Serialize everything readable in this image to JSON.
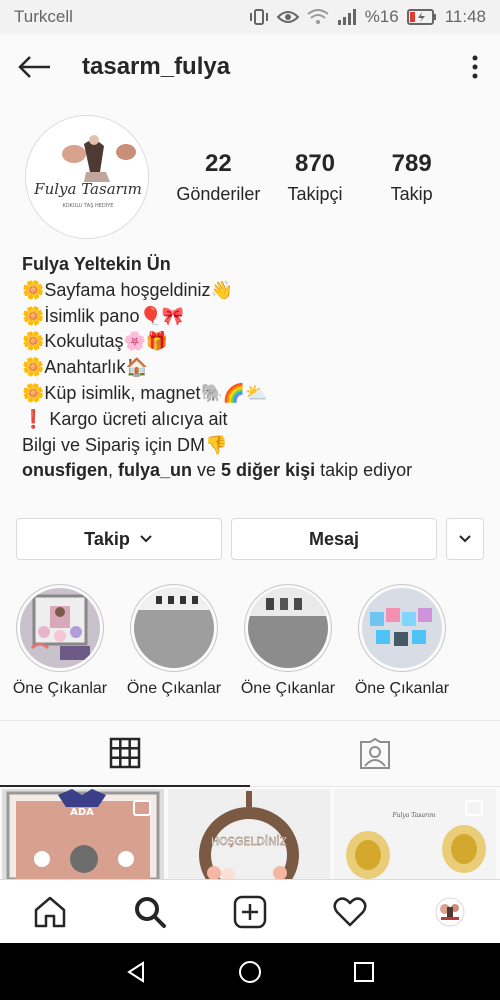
{
  "statusbar": {
    "carrier": "Turkcell",
    "battery": "%16",
    "time": "11:48"
  },
  "header": {
    "username": "tasarm_fulya",
    "back_icon": "arrow-left-icon",
    "more_icon": "vertical-dots-icon"
  },
  "profile": {
    "avatar_logo_title": "Fulya Tasarım",
    "avatar_logo_subtitle": "KOKULU TAŞ HEDİYE",
    "stats": [
      {
        "value": "22",
        "label": "Gönderiler"
      },
      {
        "value": "870",
        "label": "Takipçi"
      },
      {
        "value": "789",
        "label": "Takip"
      }
    ]
  },
  "bio": {
    "name": "Fulya Yeltekin Ün",
    "lines": [
      "🌼Sayfama hoşgeldiniz👋",
      "🌼İsimlik pano🎈🎀",
      "🌼Kokulutaş🌸🎁",
      "🌼Anahtarlık🏠",
      "🌼Küp isimlik, magnet🐘🌈⛅",
      "❗ Kargo ücreti alıcıya ait",
      "Bilgi ve Sipariş için DM👎"
    ],
    "followed_by": {
      "user1": "onusfigen",
      "sep1": ", ",
      "user2": "fulya_un",
      "and": " ve ",
      "others": "5 diğer kişi",
      "suffix": " takip ediyor"
    }
  },
  "actions": {
    "follow_label": "Takip",
    "message_label": "Mesaj"
  },
  "highlights": [
    {
      "label": "Öne Çıkanlar"
    },
    {
      "label": "Öne Çıkanlar"
    },
    {
      "label": "Öne Çıkanlar"
    },
    {
      "label": "Öne Çıkanlar"
    }
  ],
  "tabs": [
    {
      "icon": "grid-icon",
      "active": true
    },
    {
      "icon": "tagged-person-icon",
      "active": false
    }
  ],
  "grid_posts": [
    {
      "text": "ADA",
      "multi": true
    },
    {
      "text": "HOŞGELDİNİZ",
      "multi": false
    },
    {
      "text": "Fulya Tasarım",
      "multi": true
    }
  ],
  "bottom_nav": [
    "home-icon",
    "search-icon",
    "add-post-icon",
    "heart-icon",
    "profile-avatar-icon"
  ],
  "colors": {
    "text": "#262626",
    "border": "#dbdbdb",
    "background": "#fafafa"
  }
}
